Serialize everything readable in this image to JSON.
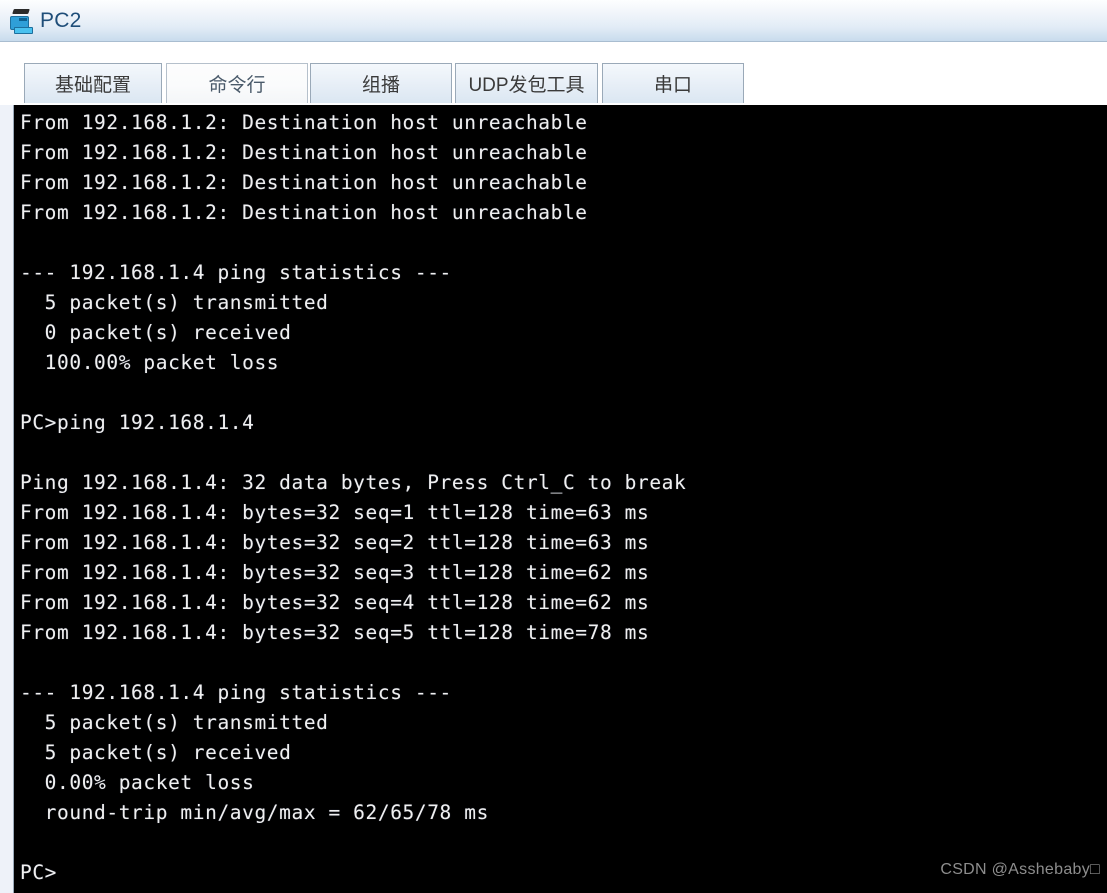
{
  "window": {
    "title": "PC2",
    "icon": "pc-device-icon"
  },
  "tabs": [
    {
      "label": "基础配置",
      "active": false,
      "name": "tab-basic-config"
    },
    {
      "label": "命令行",
      "active": true,
      "name": "tab-command-line"
    },
    {
      "label": "组播",
      "active": false,
      "name": "tab-multicast"
    },
    {
      "label": "UDP发包工具",
      "active": false,
      "name": "tab-udp-packet-tool"
    },
    {
      "label": "串口",
      "active": false,
      "name": "tab-serial-port"
    }
  ],
  "terminal": {
    "prompt": "PC>",
    "text": "From 192.168.1.2: Destination host unreachable\nFrom 192.168.1.2: Destination host unreachable\nFrom 192.168.1.2: Destination host unreachable\nFrom 192.168.1.2: Destination host unreachable\n\n--- 192.168.1.4 ping statistics ---\n  5 packet(s) transmitted\n  0 packet(s) received\n  100.00% packet loss\n\nPC>ping 192.168.1.4\n\nPing 192.168.1.4: 32 data bytes, Press Ctrl_C to break\nFrom 192.168.1.4: bytes=32 seq=1 ttl=128 time=63 ms\nFrom 192.168.1.4: bytes=32 seq=2 ttl=128 time=63 ms\nFrom 192.168.1.4: bytes=32 seq=3 ttl=128 time=62 ms\nFrom 192.168.1.4: bytes=32 seq=4 ttl=128 time=62 ms\nFrom 192.168.1.4: bytes=32 seq=5 ttl=128 time=78 ms\n\n--- 192.168.1.4 ping statistics ---\n  5 packet(s) transmitted\n  5 packet(s) received\n  0.00% packet loss\n  round-trip min/avg/max = 62/65/78 ms\n\nPC>",
    "lines": [
      "From 192.168.1.2: Destination host unreachable",
      "From 192.168.1.2: Destination host unreachable",
      "From 192.168.1.2: Destination host unreachable",
      "From 192.168.1.2: Destination host unreachable",
      "",
      "--- 192.168.1.4 ping statistics ---",
      "  5 packet(s) transmitted",
      "  0 packet(s) received",
      "  100.00% packet loss",
      "",
      "PC>ping 192.168.1.4",
      "",
      "Ping 192.168.1.4: 32 data bytes, Press Ctrl_C to break",
      "From 192.168.1.4: bytes=32 seq=1 ttl=128 time=63 ms",
      "From 192.168.1.4: bytes=32 seq=2 ttl=128 time=63 ms",
      "From 192.168.1.4: bytes=32 seq=3 ttl=128 time=62 ms",
      "From 192.168.1.4: bytes=32 seq=4 ttl=128 time=62 ms",
      "From 192.168.1.4: bytes=32 seq=5 ttl=128 time=78 ms",
      "",
      "--- 192.168.1.4 ping statistics ---",
      "  5 packet(s) transmitted",
      "  5 packet(s) received",
      "  0.00% packet loss",
      "  round-trip min/avg/max = 62/65/78 ms",
      "",
      "PC>"
    ]
  },
  "watermark": {
    "text": "CSDN @Asshebaby□"
  },
  "colors": {
    "titlebar_top": "#fdfeff",
    "titlebar_bottom": "#c9dced",
    "title_text": "#1f4e79",
    "terminal_bg": "#000000",
    "terminal_fg": "#f0f0f0",
    "tab_border": "#9aa9b8",
    "watermark_fg": "#8d8d8d"
  }
}
